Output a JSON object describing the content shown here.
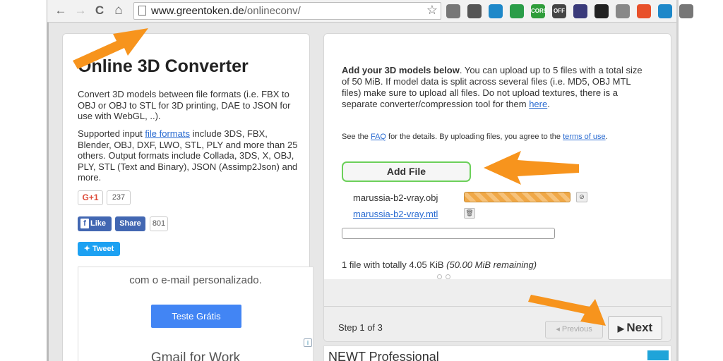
{
  "browser": {
    "url_domain": "www.greentoken.de",
    "url_path": "/onlineconv/",
    "nav": {
      "back": "←",
      "forward": "→",
      "reload": "C",
      "home": "⌂"
    },
    "extensions": [
      {
        "name": "cast-icon",
        "color": "#777777",
        "label": ""
      },
      {
        "name": "film-icon",
        "color": "#555555",
        "label": ""
      },
      {
        "name": "globe-icon",
        "color": "#1e88c9",
        "label": ""
      },
      {
        "name": "globe-icon",
        "color": "#2a9d48",
        "label": ""
      },
      {
        "name": "cors-icon",
        "color": "#2f9d3a",
        "label": "CORS"
      },
      {
        "name": "off-icon",
        "color": "#444444",
        "label": "OFF"
      },
      {
        "name": "gauge-icon",
        "color": "#3a3a7a",
        "label": ""
      },
      {
        "name": "mask-icon",
        "color": "#222222",
        "label": ""
      },
      {
        "name": "camera-icon",
        "color": "#888888",
        "label": ""
      },
      {
        "name": "fire-icon",
        "color": "#e8502a",
        "label": ""
      },
      {
        "name": "globe-icon",
        "color": "#1e88c9",
        "label": ""
      },
      {
        "name": "menu-icon",
        "color": "#777777",
        "label": ""
      }
    ]
  },
  "left": {
    "title": "Online 3D Converter",
    "p1": "Convert 3D models between file formats (i.e. FBX to OBJ or OBJ to STL for 3D printing, DAE to JSON for use with WebGL, ..).",
    "p2_pre": "Supported input ",
    "p2_link": "file formats",
    "p2_post": " include 3DS, FBX, Blender, OBJ, DXF, LWO, STL, PLY and more than 25 others. Output formats include Collada, 3DS, X, OBJ, PLY, STL (Text and Binary), JSON (Assimp2Json) and more.",
    "gplus_label": "G+1",
    "gplus_count": "237",
    "fb_like": "Like",
    "fb_share": "Share",
    "fb_count": "801",
    "tweet": "Tweet",
    "ad_text": "com o e-mail personalizado.",
    "ad_button": "Teste Grátis",
    "ad_heading": "Gmail for Work",
    "ad_info": "i"
  },
  "right": {
    "intro_bold": "Add your 3D models below",
    "intro_rest": ". You can upload up to 5 files with a total size of 50 MiB. If model data is split across several files (i.e. MD5, OBJ MTL files) make sure to upload all files. Do not upload textures, there is a separate converter/compression tool for them ",
    "intro_link": "here",
    "intro_end": ".",
    "faq_pre": "See the ",
    "faq_link": "FAQ",
    "faq_mid": " for the details. By uploading files, you agree to the ",
    "faq_link2": "terms of use",
    "faq_end": ".",
    "add_file": "Add File",
    "files": [
      {
        "name": "marussia-b2-vray.obj",
        "progress": 1.0
      },
      {
        "name": "marussia-b2-vray.mtl"
      }
    ],
    "summary_plain": "1 file with totally 4.05 KiB ",
    "summary_italic": "(50.00 MiB remaining)",
    "step": "Step 1 of 3",
    "previous": "Previous",
    "next": "Next"
  },
  "newt_ad": "NEWT Professional",
  "colors": {
    "accent": "#6cd05a",
    "arrow": "#f7941d",
    "link": "#2a6bd1"
  }
}
